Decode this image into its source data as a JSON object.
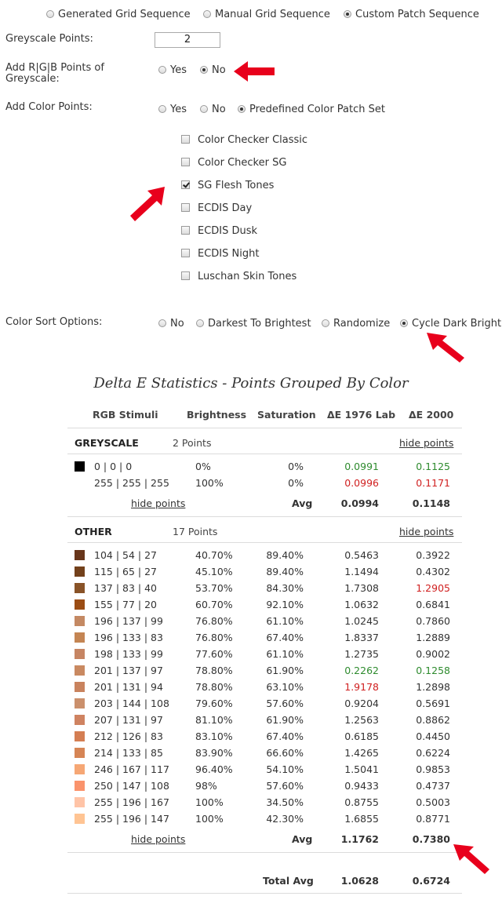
{
  "sequence_options": [
    {
      "label": "Generated Grid Sequence",
      "selected": false
    },
    {
      "label": "Manual Grid Sequence",
      "selected": false
    },
    {
      "label": "Custom Patch Sequence",
      "selected": true
    }
  ],
  "greyscale_points": {
    "label": "Greyscale Points:",
    "value": "2"
  },
  "add_rgb": {
    "label_line1": "Add R|G|B Points of",
    "label_line2": "Greyscale:",
    "options": [
      {
        "label": "Yes",
        "selected": false
      },
      {
        "label": "No",
        "selected": true
      }
    ]
  },
  "add_color": {
    "label": "Add Color Points:",
    "options": [
      {
        "label": "Yes",
        "selected": false
      },
      {
        "label": "No",
        "selected": false
      },
      {
        "label": "Predefined Color Patch Set",
        "selected": true
      }
    ]
  },
  "patch_sets": [
    {
      "label": "Color Checker Classic",
      "checked": false
    },
    {
      "label": "Color Checker SG",
      "checked": false
    },
    {
      "label": "SG Flesh Tones",
      "checked": true
    },
    {
      "label": "ECDIS Day",
      "checked": false
    },
    {
      "label": "ECDIS Dusk",
      "checked": false
    },
    {
      "label": "ECDIS Night",
      "checked": false
    },
    {
      "label": "Luschan Skin Tones",
      "checked": false
    }
  ],
  "sort": {
    "label": "Color Sort Options:",
    "options": [
      {
        "label": "No",
        "selected": false
      },
      {
        "label": "Darkest To Brightest",
        "selected": false
      },
      {
        "label": "Randomize",
        "selected": false
      },
      {
        "label": "Cycle Dark Bright",
        "selected": true
      }
    ]
  },
  "stats": {
    "title": "Delta E Statistics - Points Grouped By Color",
    "headers": {
      "rgb": "RGB Stimuli",
      "brightness": "Brightness",
      "saturation": "Saturation",
      "de1976": "ΔE 1976 Lab",
      "de2000": "ΔE 2000"
    },
    "greyscale": {
      "name": "GREYSCALE",
      "count": "2 Points",
      "hide": "hide points",
      "rows": [
        {
          "swatch": "#000000",
          "rgb": "0 | 0 | 0",
          "brightness": "0%",
          "saturation": "0%",
          "de1976": "0.0991",
          "de1976_color": "green",
          "de2000": "0.1125",
          "de2000_color": "green"
        },
        {
          "swatch": "",
          "rgb": "255 | 255 | 255",
          "brightness": "100%",
          "saturation": "0%",
          "de1976": "0.0996",
          "de1976_color": "red",
          "de2000": "0.1171",
          "de2000_color": "red"
        }
      ],
      "avg_label": "Avg",
      "avg1976": "0.0994",
      "avg2000": "0.1148"
    },
    "other": {
      "name": "OTHER",
      "count": "17 Points",
      "hide": "hide points",
      "rows": [
        {
          "swatch": "#68361b",
          "rgb": "104 | 54 | 27",
          "brightness": "40.70%",
          "saturation": "89.40%",
          "de1976": "0.5463",
          "de1976_color": "",
          "de2000": "0.3922",
          "de2000_color": ""
        },
        {
          "swatch": "#73411b",
          "rgb": "115 | 65 | 27",
          "brightness": "45.10%",
          "saturation": "89.40%",
          "de1976": "1.1494",
          "de1976_color": "",
          "de2000": "0.4302",
          "de2000_color": ""
        },
        {
          "swatch": "#895328",
          "rgb": "137 | 83 | 40",
          "brightness": "53.70%",
          "saturation": "84.30%",
          "de1976": "1.7308",
          "de1976_color": "",
          "de2000": "1.2905",
          "de2000_color": "red"
        },
        {
          "swatch": "#9b4d14",
          "rgb": "155 | 77 | 20",
          "brightness": "60.70%",
          "saturation": "92.10%",
          "de1976": "1.0632",
          "de1976_color": "",
          "de2000": "0.6841",
          "de2000_color": ""
        },
        {
          "swatch": "#c48963",
          "rgb": "196 | 137 | 99",
          "brightness": "76.80%",
          "saturation": "61.10%",
          "de1976": "1.0245",
          "de1976_color": "",
          "de2000": "0.7860",
          "de2000_color": ""
        },
        {
          "swatch": "#c48553",
          "rgb": "196 | 133 | 83",
          "brightness": "76.80%",
          "saturation": "67.40%",
          "de1976": "1.8337",
          "de1976_color": "",
          "de2000": "1.2889",
          "de2000_color": ""
        },
        {
          "swatch": "#c68563",
          "rgb": "198 | 133 | 99",
          "brightness": "77.60%",
          "saturation": "61.10%",
          "de1976": "1.2735",
          "de1976_color": "",
          "de2000": "0.9002",
          "de2000_color": ""
        },
        {
          "swatch": "#c98961",
          "rgb": "201 | 137 | 97",
          "brightness": "78.80%",
          "saturation": "61.90%",
          "de1976": "0.2262",
          "de1976_color": "green",
          "de2000": "0.1258",
          "de2000_color": "green"
        },
        {
          "swatch": "#c9835e",
          "rgb": "201 | 131 | 94",
          "brightness": "78.80%",
          "saturation": "63.10%",
          "de1976": "1.9178",
          "de1976_color": "red",
          "de2000": "1.2898",
          "de2000_color": ""
        },
        {
          "swatch": "#cb906c",
          "rgb": "203 | 144 | 108",
          "brightness": "79.60%",
          "saturation": "57.60%",
          "de1976": "0.9204",
          "de1976_color": "",
          "de2000": "0.5691",
          "de2000_color": ""
        },
        {
          "swatch": "#cf8361",
          "rgb": "207 | 131 | 97",
          "brightness": "81.10%",
          "saturation": "61.90%",
          "de1976": "1.2563",
          "de1976_color": "",
          "de2000": "0.8862",
          "de2000_color": ""
        },
        {
          "swatch": "#d47e53",
          "rgb": "212 | 126 | 83",
          "brightness": "83.10%",
          "saturation": "67.40%",
          "de1976": "0.6185",
          "de1976_color": "",
          "de2000": "0.4450",
          "de2000_color": ""
        },
        {
          "swatch": "#d68555",
          "rgb": "214 | 133 | 85",
          "brightness": "83.90%",
          "saturation": "66.60%",
          "de1976": "1.4265",
          "de1976_color": "",
          "de2000": "0.6224",
          "de2000_color": ""
        },
        {
          "swatch": "#f6a775",
          "rgb": "246 | 167 | 117",
          "brightness": "96.40%",
          "saturation": "54.10%",
          "de1976": "1.5041",
          "de1976_color": "",
          "de2000": "0.9853",
          "de2000_color": ""
        },
        {
          "swatch": "#fa936c",
          "rgb": "250 | 147 | 108",
          "brightness": "98%",
          "saturation": "57.60%",
          "de1976": "0.9433",
          "de1976_color": "",
          "de2000": "0.4737",
          "de2000_color": ""
        },
        {
          "swatch": "#ffc4a7",
          "rgb": "255 | 196 | 167",
          "brightness": "100%",
          "saturation": "34.50%",
          "de1976": "0.8755",
          "de1976_color": "",
          "de2000": "0.5003",
          "de2000_color": ""
        },
        {
          "swatch": "#ffc493",
          "rgb": "255 | 196 | 147",
          "brightness": "100%",
          "saturation": "42.30%",
          "de1976": "1.6855",
          "de1976_color": "",
          "de2000": "0.8771",
          "de2000_color": ""
        }
      ],
      "avg_label": "Avg",
      "avg1976": "1.1762",
      "avg2000": "0.7380"
    },
    "total": {
      "label": "Total Avg",
      "de1976": "1.0628",
      "de2000": "0.6724"
    }
  },
  "colors": {
    "arrow": "#e8001c",
    "good": "#2e8b2e",
    "bad": "#d02020"
  }
}
